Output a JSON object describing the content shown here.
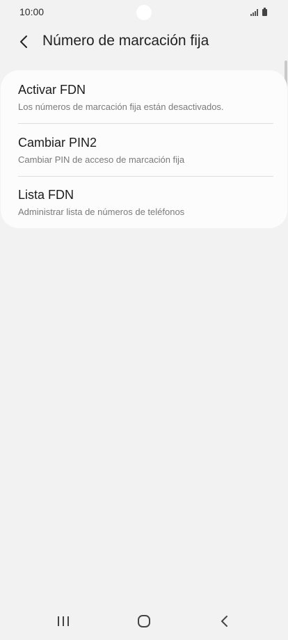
{
  "status_bar": {
    "time": "10:00",
    "icons": [
      "signal-icon",
      "battery-icon"
    ]
  },
  "header": {
    "title": "Número de marcación fija",
    "back_icon": "chevron-left-icon"
  },
  "list": {
    "items": [
      {
        "title": "Activar FDN",
        "subtitle": "Los números de marcación fija están desactivados."
      },
      {
        "title": "Cambiar PIN2",
        "subtitle": "Cambiar PIN de acceso de marcación fija"
      },
      {
        "title": "Lista FDN",
        "subtitle": "Administrar lista de números de teléfonos"
      }
    ]
  },
  "nav_bar": {
    "buttons": [
      "recent-apps-icon",
      "home-icon",
      "back-icon"
    ]
  },
  "colors": {
    "background": "#f2f2f2",
    "card": "#fcfcfc",
    "title_text": "#1c1c1c",
    "subtitle_text": "#7a7a7a"
  }
}
